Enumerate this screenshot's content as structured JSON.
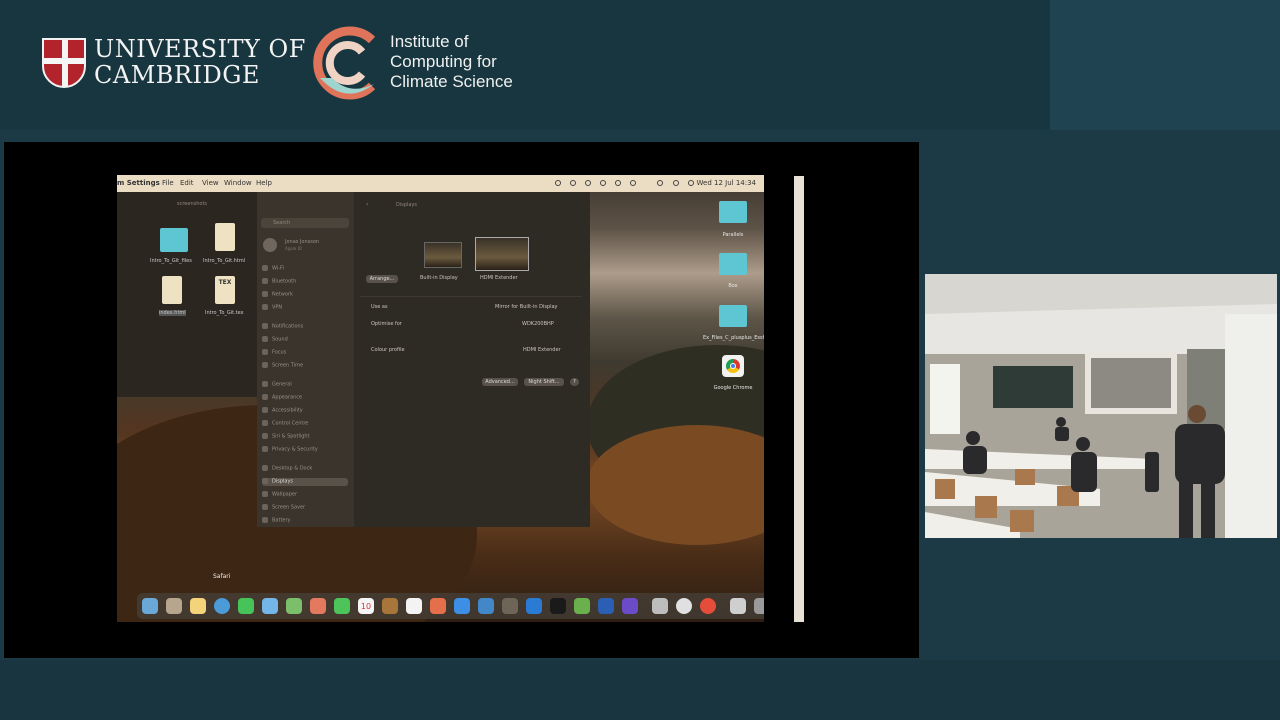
{
  "header": {
    "university_line1": "UNIVERSITY OF",
    "university_line2": "CAMBRIDGE",
    "institute_line1": "Institute of",
    "institute_line2": "Computing for",
    "institute_line3": "Climate Science"
  },
  "colors": {
    "background": "#1b3a45",
    "iccs_orange": "#e0745a",
    "iccs_teal": "#9ed6cf",
    "folder": "#5ec6d3"
  },
  "menubar": {
    "app": "m Settings",
    "items": [
      "File",
      "Edit",
      "View",
      "Window",
      "Help"
    ],
    "clock": "Wed 12 Jul 14:34"
  },
  "finder": {
    "title": "screenshots",
    "files": [
      {
        "name": "Intro_To_Git_files",
        "icon": "folder-icon"
      },
      {
        "name": "Intro_To_Git.html",
        "icon": "document-icon"
      },
      {
        "name": "index.html",
        "icon": "document-icon"
      },
      {
        "name": "Intro_To_Git.tex",
        "icon": "tex-document-icon"
      }
    ]
  },
  "settings": {
    "search_placeholder": "Search",
    "user_name": "Jonas Jonsson",
    "user_sub": "Apple ID",
    "sidebar": [
      "Wi-Fi",
      "Bluetooth",
      "Network",
      "VPN",
      "Notifications",
      "Sound",
      "Focus",
      "Screen Time",
      "General",
      "Appearance",
      "Accessibility",
      "Control Centre",
      "Siri & Spotlight",
      "Privacy & Security",
      "Desktop & Dock",
      "Displays",
      "Wallpaper",
      "Screen Saver",
      "Battery"
    ],
    "selected": "Displays",
    "panel_title": "Displays",
    "arrange_button": "Arrange...",
    "displays": [
      "Built-in Display",
      "HDMI Extender"
    ],
    "rows": [
      {
        "label": "Use as",
        "value": "Mirror for Built-in Display"
      },
      {
        "label": "Optimise for",
        "value": "WDK200BHP"
      },
      {
        "label": "Colour profile",
        "value": "HDMI Extender"
      }
    ],
    "advanced_button": "Advanced...",
    "night_shift_button": "Night Shift...",
    "help_button": "?"
  },
  "desktop_icons": [
    {
      "name": "Parallels"
    },
    {
      "name": "Box"
    },
    {
      "name": "Ex_Files_C_plusplus_Essf"
    },
    {
      "name": "Google Chrome"
    }
  ],
  "dock": {
    "tooltip": "Safari",
    "calendar_date": "10"
  }
}
